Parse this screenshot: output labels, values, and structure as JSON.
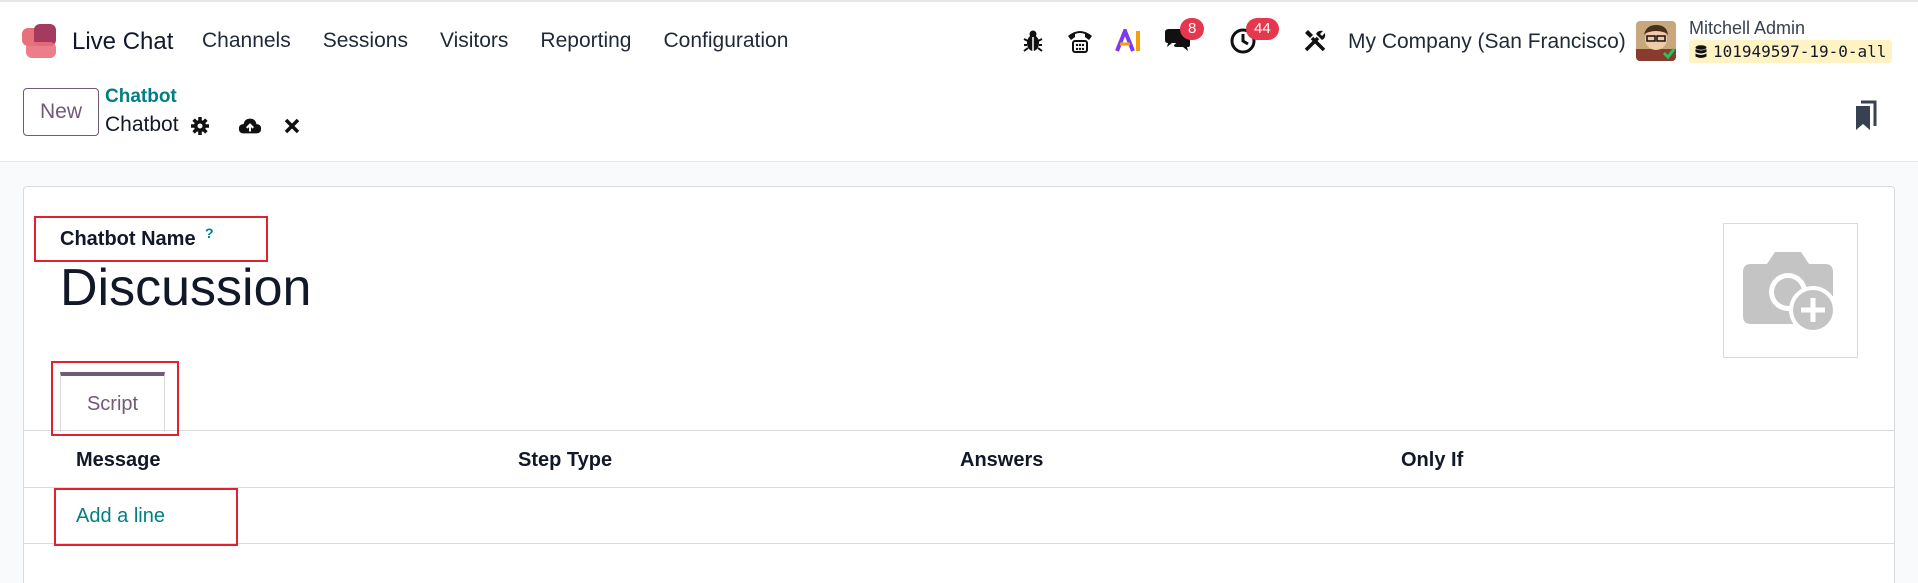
{
  "app": {
    "name": "Live Chat",
    "menu": [
      "Channels",
      "Sessions",
      "Visitors",
      "Reporting",
      "Configuration"
    ]
  },
  "systray": {
    "messages_count": "8",
    "activities_count": "44",
    "company": "My Company (San Francisco)",
    "user_name": "Mitchell Admin",
    "database": "101949597-19-0-all"
  },
  "control_panel": {
    "new_label": "New",
    "breadcrumb_parent": "Chatbot",
    "breadcrumb_current": "Chatbot"
  },
  "form": {
    "name_label": "Chatbot Name",
    "help_mark": "?",
    "name_value": "Discussion",
    "tab": "Script",
    "columns": [
      "Message",
      "Step Type",
      "Answers",
      "Only If"
    ],
    "add_line_label": "Add a line"
  },
  "colors": {
    "primary": "#71597a",
    "link": "#017e84",
    "badge": "#e5384f",
    "highlight": "#e1212e"
  }
}
